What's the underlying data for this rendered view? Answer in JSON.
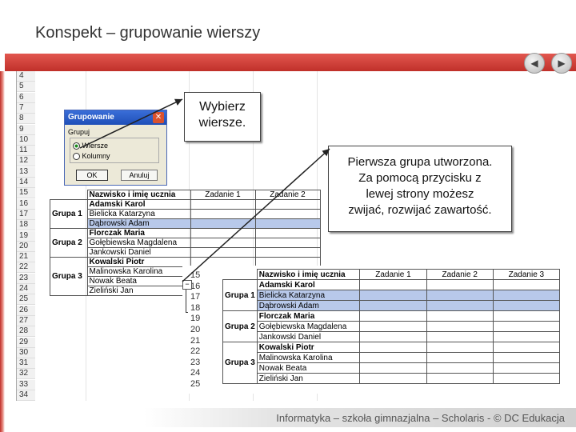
{
  "header": {
    "title": "Konspekt – grupowanie wierszy"
  },
  "nav": {
    "prev_icon": "◀",
    "next_icon": "▶"
  },
  "sheet_back": {
    "row_numbers": [
      "4",
      "5",
      "6",
      "7",
      "8",
      "9",
      "10",
      "11",
      "12",
      "13",
      "14",
      "15",
      "16",
      "17",
      "18",
      "19",
      "20",
      "21",
      "22",
      "23",
      "24",
      "25",
      "26",
      "27",
      "28",
      "29",
      "30",
      "31",
      "32",
      "33",
      "34"
    ],
    "headers": [
      "Nazwisko i imię ucznia",
      "Zadanie 1",
      "Zadanie 2"
    ],
    "rows": [
      {
        "group": "",
        "name": "Adamski Karol"
      },
      {
        "group": "Grupa 1",
        "name": "Bielicka Katarzyna"
      },
      {
        "group": "",
        "name": "Dąbrowski Adam"
      },
      {
        "group": "",
        "name": "Florczak Maria"
      },
      {
        "group": "Grupa 2",
        "name": "Gołębiewska Magdalena"
      },
      {
        "group": "",
        "name": "Jankowski Daniel"
      },
      {
        "group": "",
        "name": "Kowalski Piotr"
      },
      {
        "group": "Grupa 3",
        "name": "Malinowska Karolina"
      },
      {
        "group": "",
        "name": "Nowak Beata"
      },
      {
        "group": "",
        "name": "Zieliński Jan"
      }
    ]
  },
  "dialog": {
    "title": "Grupowanie",
    "close": "✕",
    "section": "Grupuj",
    "options": [
      "Wiersze",
      "Kolumny"
    ],
    "ok": "OK",
    "cancel": "Anuluj"
  },
  "callout1": {
    "line1": "Wybierz",
    "line2": "wiersze."
  },
  "callout2": {
    "line1": "Pierwsza grupa utworzona.",
    "line2": "Za pomocą przycisku z",
    "line3": "lewej strony możesz",
    "line4": "zwijać, rozwijać zawartość."
  },
  "sheet_front": {
    "row_numbers": [
      "15",
      "16",
      "17",
      "18",
      "19",
      "20",
      "21",
      "22",
      "23",
      "24",
      "25"
    ],
    "collapse_btn": "−",
    "headers": [
      "Nazwisko i imię ucznia",
      "Zadanie 1",
      "Zadanie 2",
      "Zadanie 3"
    ],
    "rows": [
      {
        "group": "",
        "name": "Adamski Karol"
      },
      {
        "group": "Grupa 1",
        "name": "Bielicka Katarzyna"
      },
      {
        "group": "",
        "name": "Dąbrowski Adam"
      },
      {
        "group": "",
        "name": "Florczak Maria"
      },
      {
        "group": "Grupa 2",
        "name": "Gołębiewska Magdalena"
      },
      {
        "group": "",
        "name": "Jankowski Daniel"
      },
      {
        "group": "",
        "name": "Kowalski Piotr"
      },
      {
        "group": "Grupa 3",
        "name": "Malinowska Karolina"
      },
      {
        "group": "",
        "name": "Nowak Beata"
      },
      {
        "group": "",
        "name": "Zieliński Jan"
      }
    ]
  },
  "footer": {
    "text": "Informatyka – szkoła gimnazjalna – Scholaris - © DC Edukacja"
  },
  "colors": {
    "accent": "#c0302a",
    "selection": "#b8c9ea"
  }
}
